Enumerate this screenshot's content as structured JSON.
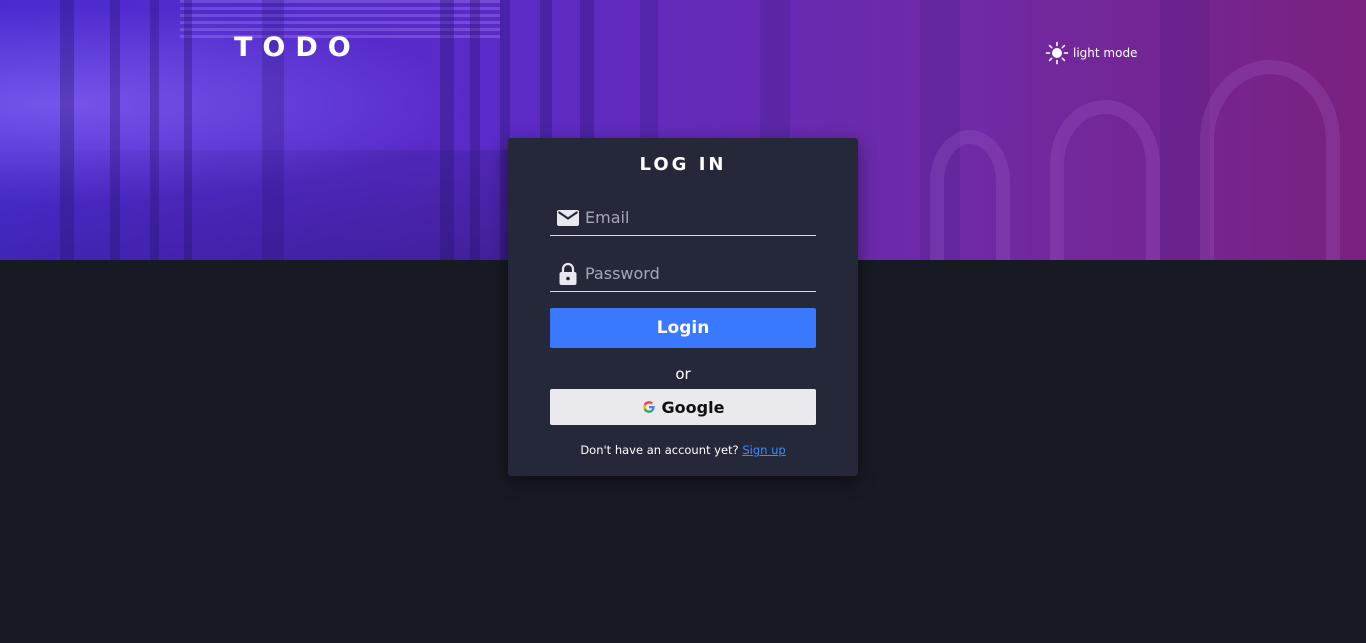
{
  "app": {
    "logo_text": "TODO"
  },
  "header": {
    "theme_toggle": {
      "icon": "sun-icon",
      "label": "light mode"
    }
  },
  "login": {
    "title": "LOG IN",
    "email": {
      "icon": "mail-icon",
      "placeholder": "Email",
      "value": ""
    },
    "password": {
      "icon": "lock-icon",
      "placeholder": "Password",
      "value": ""
    },
    "login_button": "Login",
    "separator": "or",
    "google_button": {
      "icon": "google-icon",
      "label": "Google"
    },
    "signup_prompt": "Don't have an account yet?",
    "signup_link": "Sign up"
  },
  "colors": {
    "background": "#181a23",
    "card": "#252839",
    "primary": "#3a78ff",
    "link": "#3a8bff",
    "hero_start": "#4b2bd0",
    "hero_end": "#7a2180"
  }
}
